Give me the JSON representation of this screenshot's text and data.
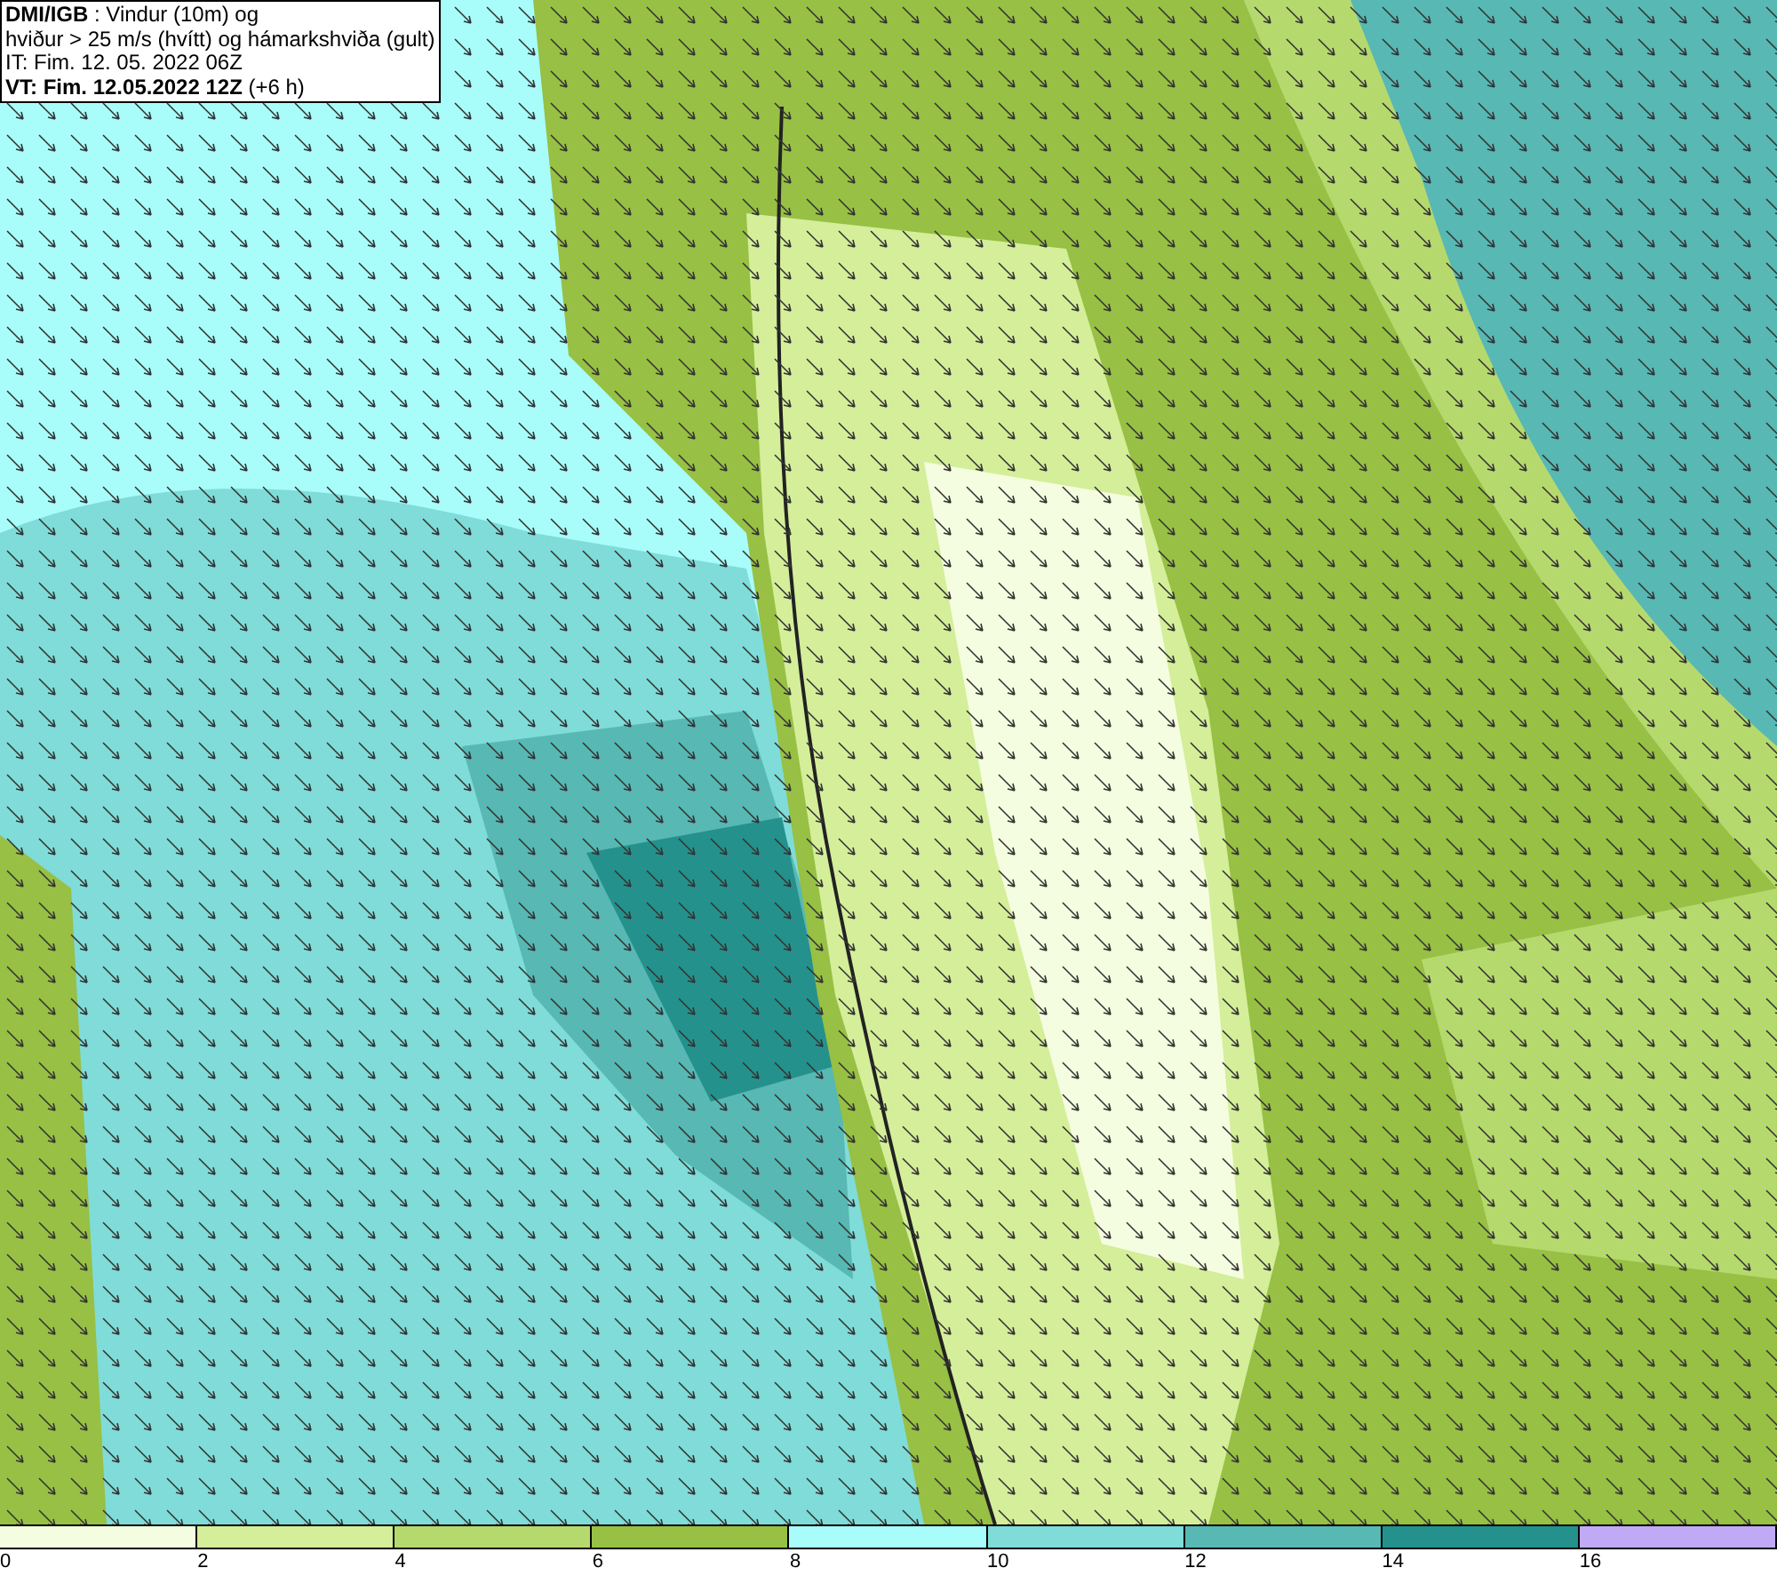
{
  "info_box": {
    "lines": [
      "**DMI/IGB** : Vindur (10m) og",
      "hviður > 25 m/s (hvítt) og hámarkshviða (gult)",
      "IT: Fim. 12. 05. 2022 06Z",
      "**VT: Fim. 12.05.2022 12Z** (+6 h)"
    ]
  },
  "legend": {
    "segments": [
      {
        "label": "0",
        "color": "#f5fde0"
      },
      {
        "label": "2",
        "color": "#d4ee9a"
      },
      {
        "label": "4",
        "color": "#b6d96e"
      },
      {
        "label": "6",
        "color": "#97c044"
      },
      {
        "label": "8",
        "color": "#a8fcfa"
      },
      {
        "label": "10",
        "color": "#7fdcd8"
      },
      {
        "label": "12",
        "color": "#57b8b4"
      },
      {
        "label": "14",
        "color": "#25918c"
      },
      {
        "label": "16",
        "color": "#c0aaf5"
      }
    ]
  }
}
